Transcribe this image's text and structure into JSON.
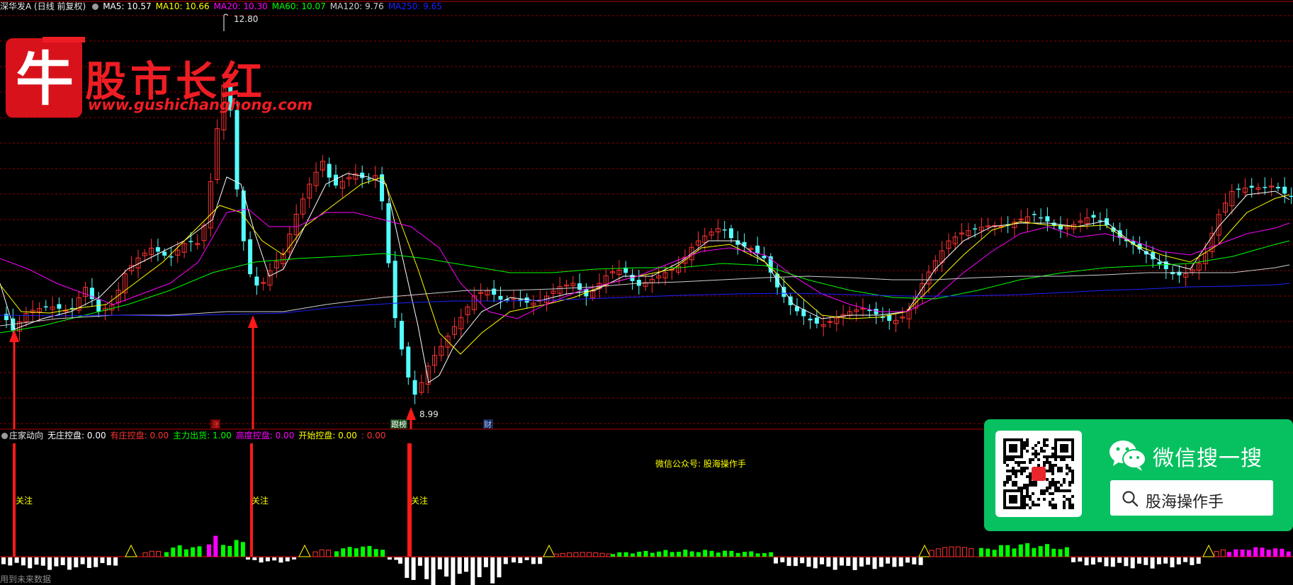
{
  "header": {
    "title": "深华发A (日线 前复权)",
    "ma5": "MA5: 10.57",
    "ma10": "MA10: 10.66",
    "ma20": "MA20: 10.30",
    "ma60": "MA60: 10.07",
    "ma120": "MA120: 9.76",
    "ma250": "MA250: 9.65"
  },
  "price_labels": {
    "high": "12.80",
    "low": "8.99"
  },
  "markers": [
    "涨",
    "跟榜",
    "财"
  ],
  "watermark": {
    "logo_char": "牛",
    "title": "股市长红",
    "url": "www.gushichanghong.com"
  },
  "indicator": {
    "name": "庄家动向",
    "no_control": "无庄控盘: 0.00",
    "has_control": "有庄控盘: 0.00",
    "main_out": "主力出货: 1.00",
    "high_control": "高度控盘: 0.00",
    "start_control": "开始控盘: 0.00",
    "extra": ": 0.00",
    "watch_label": "关注",
    "public_account": "微信公众号: 股海操作手"
  },
  "footer": "用到未来数据",
  "wechat": {
    "title": "微信搜一搜",
    "search_text": "股海操作手"
  },
  "colors": {
    "up": "#ff3333",
    "down": "#54ffff",
    "grid": "#8b0000",
    "ma5": "#ffffff",
    "ma10": "#ffff00",
    "ma20": "#ff00ff",
    "ma60": "#00ff00",
    "ma120": "#cfcfcf",
    "ma250": "#2020ff",
    "wechat_green": "#07c160"
  },
  "chart_data": {
    "type": "candlestick",
    "y_range": [
      8.99,
      12.8
    ],
    "series": [
      {
        "name": "MA5",
        "value": 10.57
      },
      {
        "name": "MA10",
        "value": 10.66
      },
      {
        "name": "MA20",
        "value": 10.3
      },
      {
        "name": "MA60",
        "value": 10.07
      },
      {
        "name": "MA120",
        "value": 9.76
      },
      {
        "name": "MA250",
        "value": 9.65
      }
    ]
  }
}
